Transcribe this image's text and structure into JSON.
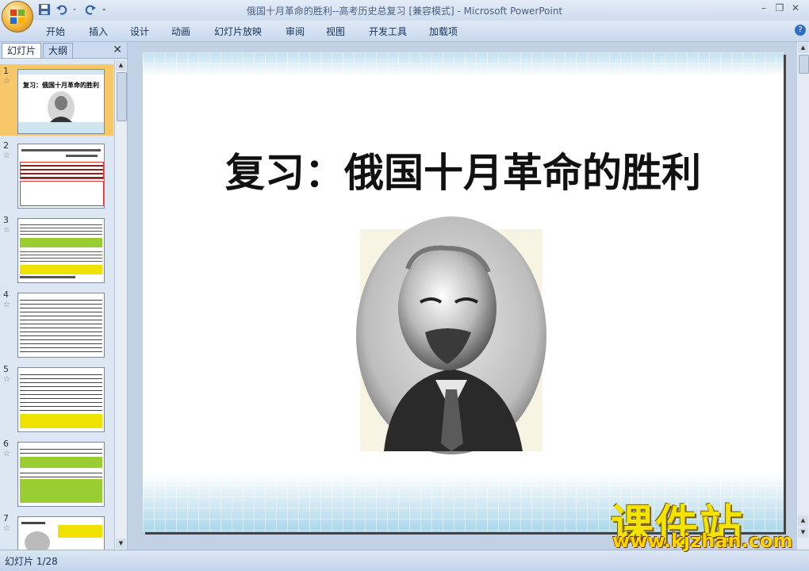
{
  "window": {
    "title": "俄国十月革命的胜利--高考历史总复习 [兼容模式] - Microsoft PowerPoint"
  },
  "ribbon": {
    "tabs": [
      "开始",
      "插入",
      "设计",
      "动画",
      "幻灯片放映",
      "审阅",
      "视图",
      "开发工具",
      "加载项"
    ]
  },
  "pane": {
    "tab_slides": "幻灯片",
    "tab_outline": "大纲",
    "thumb1_title": "复习：俄国十月革命的胜利",
    "slides": [
      {
        "num": "1",
        "marker": "☆"
      },
      {
        "num": "2",
        "marker": "☆"
      },
      {
        "num": "3",
        "marker": "☆"
      },
      {
        "num": "4",
        "marker": "☆"
      },
      {
        "num": "5",
        "marker": "☆"
      },
      {
        "num": "6",
        "marker": "☆"
      },
      {
        "num": "7",
        "marker": "☆"
      }
    ]
  },
  "slide": {
    "title": "复习：俄国十月革命的胜利"
  },
  "status": {
    "slide_counter": "幻灯片 1/28"
  },
  "watermark": {
    "text_cn": "课件站",
    "url": "www.kjzhan.com"
  },
  "colors": {
    "selected_thumb": "#f7c86a",
    "watermark": "#f2e400"
  }
}
